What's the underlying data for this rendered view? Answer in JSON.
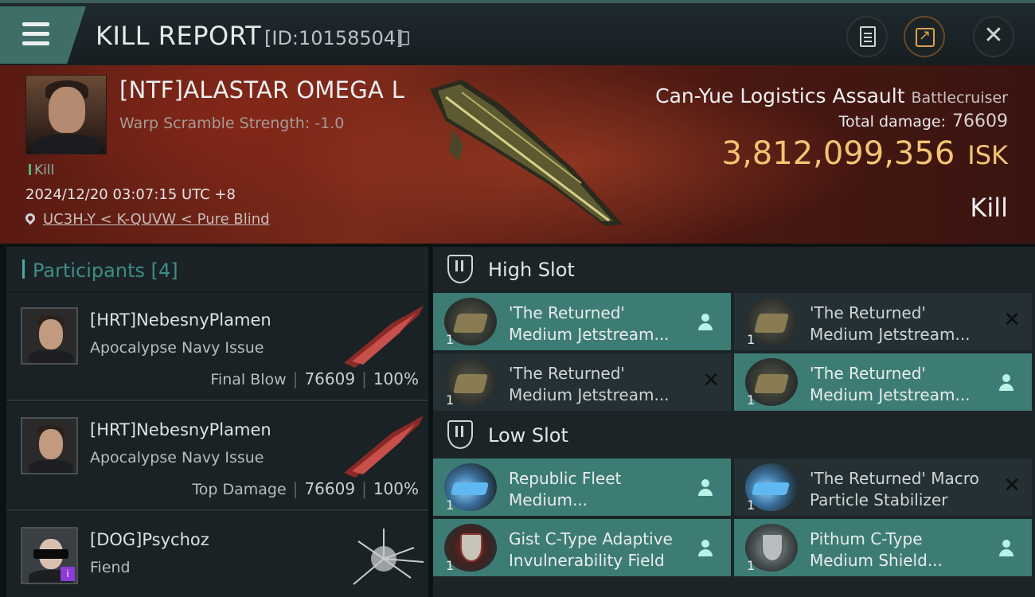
{
  "header": {
    "title": "KILL REPORT",
    "id_label": "[ID:10158504]"
  },
  "victim": {
    "name": "[NTF]ALASTAR OMEGA L",
    "scramble": "Warp Scramble Strength: -1.0",
    "kill_tag": "Kill",
    "timestamp": "2024/12/20 03:07:15 UTC +8",
    "location": "UC3H-Y < K-QUVW < Pure Blind",
    "ship_name": "Can-Yue Logistics Assault",
    "ship_class": "Battlecruiser",
    "total_damage_label": "Total damage:",
    "total_damage": "76609",
    "isk_value": "3,812,099,356",
    "isk_unit": "ISK",
    "result": "Kill"
  },
  "participants": {
    "label": "Participants",
    "count": "[4]",
    "rows": [
      {
        "name": "[HRT]NebesnyPlamen",
        "ship": "Apocalypse Navy Issue",
        "role": "Final Blow",
        "damage": "76609",
        "percent": "100%"
      },
      {
        "name": "[HRT]NebesnyPlamen",
        "ship": "Apocalypse Navy Issue",
        "role": "Top Damage",
        "damage": "76609",
        "percent": "100%"
      },
      {
        "name": "[DOG]Psychoz",
        "ship": "Fiend",
        "badge": "i"
      }
    ]
  },
  "high_slot": {
    "label": "High Slot",
    "items": [
      {
        "name": "'The Returned'\nMedium Jetstream...",
        "qty": "1",
        "state": "active"
      },
      {
        "name": "'The Returned'\nMedium Jetstream...",
        "qty": "1",
        "state": "destroyed"
      },
      {
        "name": "'The Returned'\nMedium Jetstream...",
        "qty": "1",
        "state": "destroyed"
      },
      {
        "name": "'The Returned'\nMedium Jetstream...",
        "qty": "1",
        "state": "active"
      }
    ]
  },
  "low_slot": {
    "label": "Low Slot",
    "items": [
      {
        "name": "Republic Fleet\nMedium...",
        "qty": "1",
        "state": "active"
      },
      {
        "name": "'The Returned' Macro\nParticle Stabilizer",
        "qty": "1",
        "state": "destroyed"
      },
      {
        "name": "Gist C-Type Adaptive\nInvulnerability Field",
        "qty": "1",
        "state": "active"
      },
      {
        "name": "Pithum C-Type\nMedium Shield...",
        "qty": "1",
        "state": "active"
      }
    ]
  },
  "icons": {
    "menu": "hamburger-icon",
    "copy": "copy-icon",
    "report": "document-icon",
    "share": "share-icon",
    "close": "close-icon",
    "location": "location-pin-icon",
    "dropped": "person-icon",
    "destroyed": "x-icon"
  },
  "colors": {
    "accent_teal": "#3d7c74",
    "isk_gold": "#f2c572",
    "share_orange": "#e0a04e"
  }
}
